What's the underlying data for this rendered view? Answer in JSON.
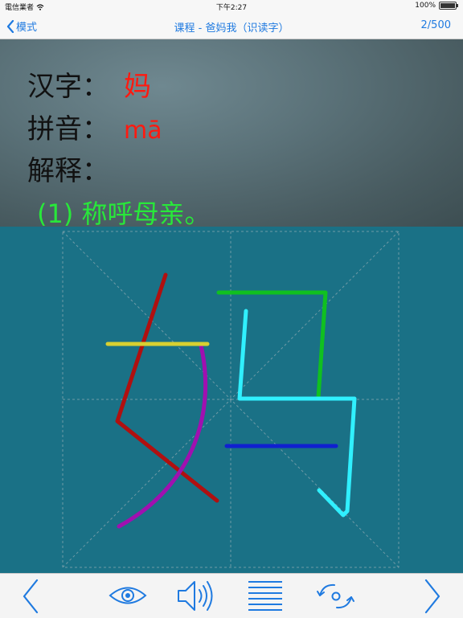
{
  "status_bar": {
    "carrier": "電信業者",
    "time": "下午2:27",
    "battery": "100%"
  },
  "nav": {
    "back_label": "模式",
    "title": "课程 - 爸妈我（识读字）",
    "page": "2/500"
  },
  "info": {
    "hanzi_label": "汉字：",
    "hanzi_value": "妈",
    "pinyin_label": "拼音：",
    "pinyin_value": "mā",
    "meaning_label": "解释：",
    "meaning_text": "(1) 称呼母亲。"
  },
  "stroke_colors": [
    "#b01010",
    "#a010b0",
    "#d8d030",
    "#10c020",
    "#30f0ff",
    "#1020d0"
  ],
  "toolbar_icons": [
    "chevron-left-icon",
    "eye-icon",
    "speaker-icon",
    "list-icon",
    "replay-icon",
    "chevron-right-icon"
  ],
  "colors": {
    "accent": "#1f7ae0",
    "board": "#1a7186",
    "hanzi_red": "#ff1a10",
    "meaning_green": "#28e83a"
  }
}
